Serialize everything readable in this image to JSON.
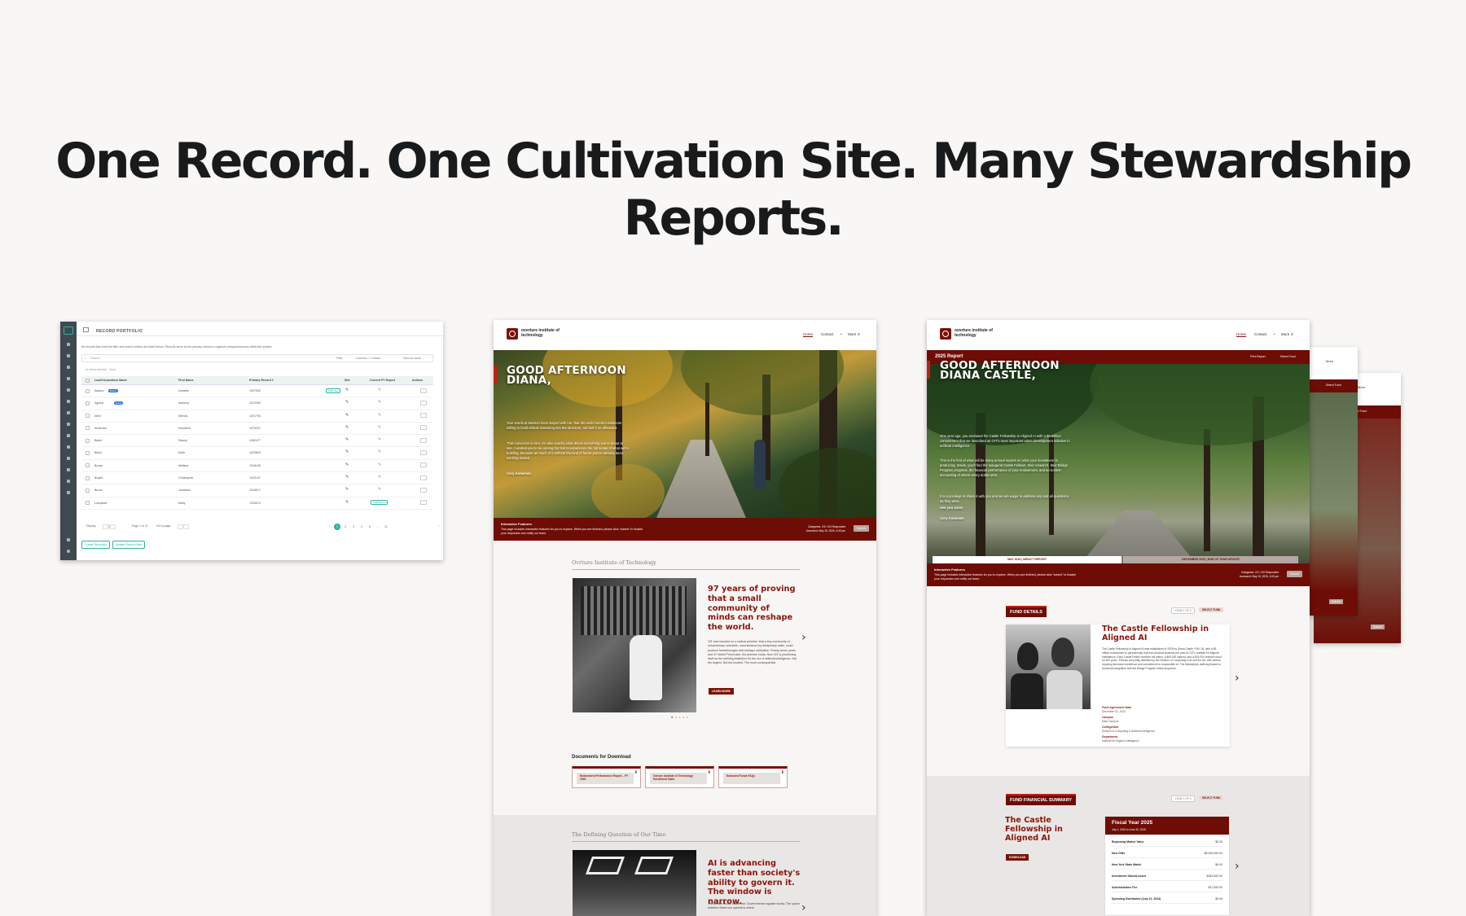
{
  "headline": "One Record. One Cultivation Site. Many Stewardship Reports.",
  "portfolio": {
    "title": "RECORD PORTFOLIO",
    "subtitle": "All records that meet the filter and search criteria are listed below. Records serve as the primary means to organize prospects/donors within the system.",
    "search_placeholder": "Search...",
    "filter": "Filter",
    "columns": "Columns • 1 hidden",
    "view_as_cards": "View as cards",
    "selected": "No items selected",
    "clear": "Clear",
    "columns_headers": [
      "Last/Corporation Name",
      "First Name",
      "Primary Record #",
      "Site",
      "Current FY Report",
      "Actions"
    ],
    "rows": [
      {
        "last": "Adams",
        "badge": "Donor",
        "first": "Danielle",
        "rec": "1397532",
        "pill": "Build Site"
      },
      {
        "last": "Aguilar",
        "badge": "Donor",
        "first": "Anthony",
        "rec": "1012394",
        "pill": ""
      },
      {
        "last": "Allen",
        "badge": "",
        "first": "Wendy",
        "rec": "1021793",
        "pill": ""
      },
      {
        "last": "Anderson",
        "badge": "",
        "first": "Elizabeth",
        "rec": "1079247",
        "pill": ""
      },
      {
        "last": "Baker",
        "badge": "",
        "first": "Stacey",
        "rec": "1082477",
        "pill": ""
      },
      {
        "last": "Black",
        "badge": "",
        "first": "Keith",
        "rec": "1023803",
        "pill": ""
      },
      {
        "last": "Brown",
        "badge": "",
        "first": "Melissa",
        "rec": "1018130",
        "pill": ""
      },
      {
        "last": "Bryant",
        "badge": "",
        "first": "Christopher",
        "rec": "1020137",
        "pill": ""
      },
      {
        "last": "Burns",
        "badge": "",
        "first": "Jonathan",
        "rec": "1015917",
        "pill": ""
      },
      {
        "last": "Campbell",
        "badge": "",
        "first": "Misty",
        "rec": "1333574",
        "pill": "Build Report"
      }
    ],
    "display": "Display",
    "display_value": "10",
    "page_info": "Page 1 of 11",
    "go_to_page": "Go to page:",
    "go_value": "1",
    "pages": [
      "1",
      "2",
      "3",
      "4",
      "5",
      "...",
      "11"
    ],
    "create_records": "Create Record(s)",
    "update_records": "Update Record Data"
  },
  "site": {
    "logo": "overture institute of technology",
    "nav": [
      "Home",
      "Contact",
      "More"
    ],
    "greeting": "GOOD AFTERNOON DIANA,",
    "hero_p1": "Your words at Madera have stayed with me: that the world needs institutions willing to build ethical reasoning into the structure, not bolt it on afterward.",
    "hero_p2": "That conviction is rare. It's also exactly what drives everything you're about to see. I wanted you to be among the first to experience the full scope of what we're building, because as much of it reflects the kind of future you've already been working toward.",
    "signature": "Cory Andersen",
    "if_title": "Interactive Features",
    "if_text": "This page includes interactive features for you to explore. When you are finished, please click \"submit\" to finalize your responses and notify our team.",
    "if_meta": "Categories: 2/2 • 0/0 Responded\nAccessed: May 19, 2026, 4:05 pm",
    "submit": "Submit",
    "kicker1": "Ovrture Institute of Technology",
    "q1": "97 years of proving that a small community of minds can reshape the world.",
    "body1": "OIT was founded on a radical premise: that a tiny community of extraordinary scientists, unconstrained by disciplinary walls, could produce breakthroughs that reshape civilization. Ninety-seven years and 47 Nobel Prizes later, the premise holds. Now OIT is positioning itself as the defining institution for the era of artificial intelligence. Not the largest. Not the loudest. The most consequential.",
    "learn_more": "LEARN MORE",
    "docs_title": "Documents for Download",
    "docs": [
      "Endowment Performance Report – FY 2026",
      "Ovrture Institute of Technology Enrollment Stats",
      "Endowed Funds FAQs"
    ],
    "kicker2": "The Defining Question of Our Time",
    "q2": "AI is advancing faster than society's ability to govern it. The window is narrow.",
    "body2": "The private sector builds fast. Governments regulate slowly. The space between these two speeds is where"
  },
  "report": {
    "nav": [
      "Home",
      "Contact",
      "More"
    ],
    "report_title": "2025 Report",
    "print_report": "Print Report",
    "select_fund": "Select Fund",
    "greeting": "GOOD AFTERNOON DIANA CASTLE,",
    "hero_p1": "One year ago, you endowed the Castle Fellowship in Aligned AI with a $5 million commitment that we described as OIT's most important talent development initiative in artificial intelligence.",
    "hero_p2": "This is the first of what will be many annual reports on what your investment is producing. Inside, you'll find the inaugural Castle Fellows, their research, their Bridge Program progress, the financial performance of your endowment, and an honest accounting of where every dollar went.",
    "hero_p3": "It is a privilege to share it with you and we are eager to address any and all questions as they arise.",
    "hero_p4": "See you soon!",
    "signature": "Cory Andersen",
    "tab1": "MAY 2025 | IMPACT REPORT",
    "tab2": "DECEMBER 2025 | END OF YEAR UPDATE",
    "fund_details": "FUND DETAILS",
    "fund_counter": "FUND 1 OF 3",
    "select_fund_btn": "SELECT FUND",
    "fund_name": "The Castle Fellowship in Aligned AI",
    "fund_desc": "The Castle Fellowship in Aligned AI was established in 2025 by Diana Castle, PhD '04, with a $5 million endowment to permanently fund two doctoral students per year at OIT's Institute for Aligned Intelligence. Each Castle Fellow receives full tuition, a $45,000 stipend, and a $15,000 research fund for five years. Fellows are jointly admitted by the Division of Computing & AI and the IAI, with criteria requiring technical excellence and commitment to responsible AI. The fellowship's defining feature is structural integration with the Bridge Program ethics sequence.",
    "details": [
      {
        "k": "Fund Agreement Date",
        "v": "December 01, 2024"
      },
      {
        "k": "Campus",
        "v": "Main Campus"
      },
      {
        "k": "College/Unit",
        "v": "Division of Computing & Artificial Intelligence"
      },
      {
        "k": "Department",
        "v": "Institute for Aligned Intelligence"
      }
    ],
    "financial_summary": "FUND FINANCIAL SUMMARY",
    "fin_fund_name": "The Castle Fellowship in Aligned AI",
    "download": "DOWNLOAD",
    "fy_title": "Fiscal Year 2025",
    "fy_sub": "July 1, 2024 to June 30, 2025",
    "fy_rows": [
      {
        "k": "Beginning Market Value",
        "v": "$0.00"
      },
      {
        "k": "New Gifts",
        "v": "$5,000,000.00"
      },
      {
        "k": "New York State Match",
        "v": "$0.00"
      },
      {
        "k": "Investment Gains/Losses",
        "v": "$182,500.00"
      },
      {
        "k": "Administrative Fee",
        "v": "$27,000.00"
      },
      {
        "k": "Spending Distributed (July 31, 2024)",
        "v": "$0.00"
      }
    ],
    "back_select_fund": "Select Fund",
    "back_more": "More",
    "back_submit": "Submit"
  }
}
